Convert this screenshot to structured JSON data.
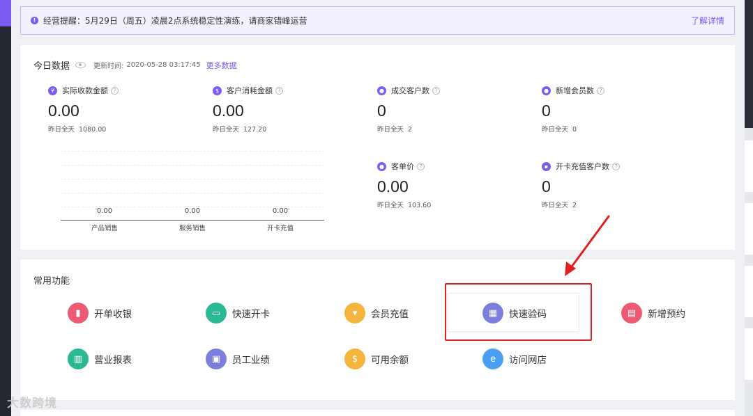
{
  "notice": {
    "text": "经营提醒：5月29日（周五）凌晨2点系统稳定性演练，请商家错峰运营",
    "link": "了解详情"
  },
  "today": {
    "title": "今日数据",
    "updated_label": "更新时间:",
    "updated_time": "2020-05-28 03:17:45",
    "more_label": "更多数据",
    "stats": [
      {
        "icon": "¥",
        "label": "实际收款金额",
        "value": "0.00",
        "yesterday_label": "昨日全天",
        "yesterday_value": "1080.00"
      },
      {
        "icon": "$",
        "label": "客户消耗金额",
        "value": "0.00",
        "yesterday_label": "昨日全天",
        "yesterday_value": "127.20"
      },
      {
        "icon": "●",
        "label": "成交客户数",
        "value": "0",
        "yesterday_label": "昨日全天",
        "yesterday_value": "2"
      },
      {
        "icon": "●",
        "label": "新增会员数",
        "value": "0",
        "yesterday_label": "昨日全天",
        "yesterday_value": "0"
      },
      {
        "icon": "●",
        "label": "客单价",
        "value": "0.00",
        "yesterday_label": "昨日全天",
        "yesterday_value": "103.60"
      },
      {
        "icon": "▪",
        "label": "开卡充值客户数",
        "value": "0",
        "yesterday_label": "昨日全天",
        "yesterday_value": "2"
      }
    ]
  },
  "chart_data": {
    "type": "bar",
    "categories": [
      "产品销售",
      "服务销售",
      "开卡充值"
    ],
    "values": [
      0,
      0,
      0
    ],
    "value_labels": [
      "0.00",
      "0.00",
      "0.00"
    ]
  },
  "functions": {
    "title": "常用功能",
    "items": [
      {
        "label": "开单收银",
        "color": "#ec5b73",
        "glyph": "▮"
      },
      {
        "label": "快速开卡",
        "color": "#2bb894",
        "glyph": "▭"
      },
      {
        "label": "会员充值",
        "color": "#f4b53c",
        "glyph": "▾"
      },
      {
        "label": "快速验码",
        "color": "#7b7fdb",
        "glyph": "▦"
      },
      {
        "label": "新增预约",
        "color": "#ec5b73",
        "glyph": "▤"
      },
      {
        "label": "营业报表",
        "color": "#2bb894",
        "glyph": "▥"
      },
      {
        "label": "员工业绩",
        "color": "#7b7fdb",
        "glyph": "▣"
      },
      {
        "label": "可用余额",
        "color": "#f4b53c",
        "glyph": "$"
      },
      {
        "label": "访问网店",
        "color": "#4a9ff0",
        "glyph": "e"
      }
    ]
  },
  "watermark": "大数跨境"
}
